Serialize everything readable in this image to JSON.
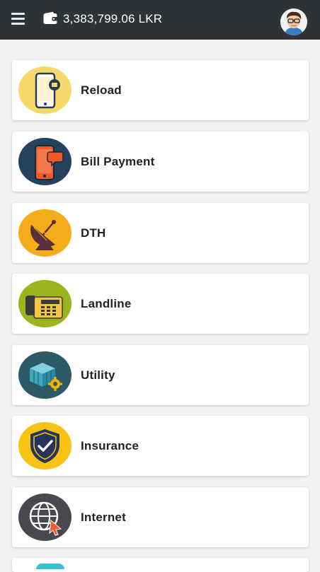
{
  "header": {
    "balance": "3,383,799.06 LKR",
    "menu_icon": "hamburger-menu-icon",
    "wallet_icon": "wallet-icon",
    "avatar_icon": "user-avatar-icon"
  },
  "services": [
    {
      "label": "Reload",
      "icon": "mobile-reload-icon",
      "color": "#f7d86a"
    },
    {
      "label": "Bill Payment",
      "icon": "mobile-bill-icon",
      "color": "#24425e"
    },
    {
      "label": "DTH",
      "icon": "satellite-dish-icon",
      "color": "#f4ac18"
    },
    {
      "label": "Landline",
      "icon": "landline-phone-icon",
      "color": "#9bb51d"
    },
    {
      "label": "Utility",
      "icon": "utility-cubes-icon",
      "color": "#2e5966"
    },
    {
      "label": "Insurance",
      "icon": "shield-check-icon",
      "color": "#f9c315"
    },
    {
      "label": "Internet",
      "icon": "globe-cursor-icon",
      "color": "#4a4750"
    }
  ],
  "colors": {
    "topbar": "#2f3237",
    "background": "#f1f2f4",
    "card": "#ffffff"
  }
}
